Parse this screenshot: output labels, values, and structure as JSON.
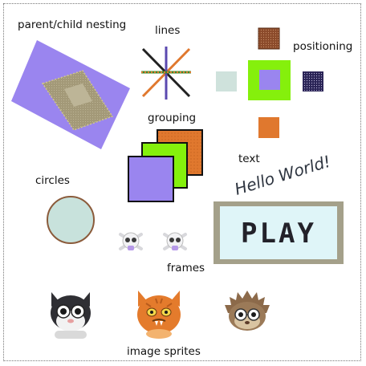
{
  "labels": {
    "parent_child_nesting": "parent/child nesting",
    "lines": "lines",
    "positioning": "positioning",
    "grouping": "grouping",
    "text": "text",
    "circles": "circles",
    "frames": "frames",
    "image_sprites": "image sprites"
  },
  "text_sample": "Hello World!",
  "play_button": "PLAY",
  "colors": {
    "purple": "#9a85ef",
    "green": "#85f00c",
    "orange": "#e0782e",
    "olive": "#a39a72",
    "pale_mint": "#cfe2dc",
    "navy_dotted": "#2a2456",
    "brown": "#8b4a2a",
    "frame_tan": "#a4a08a",
    "frame_inner": "#dff5f8",
    "text_dark": "#2e3540",
    "play_text": "#23222a",
    "circle_fill": "#c8e2dc",
    "circle_stroke": "#8b5b3b"
  },
  "icons": {
    "frames": [
      "skull-crossbones-icon",
      "skull-crossbones-icon"
    ],
    "sprites": [
      "black-white-cat-icon",
      "orange-cat-icon",
      "hedgehog-icon"
    ]
  }
}
